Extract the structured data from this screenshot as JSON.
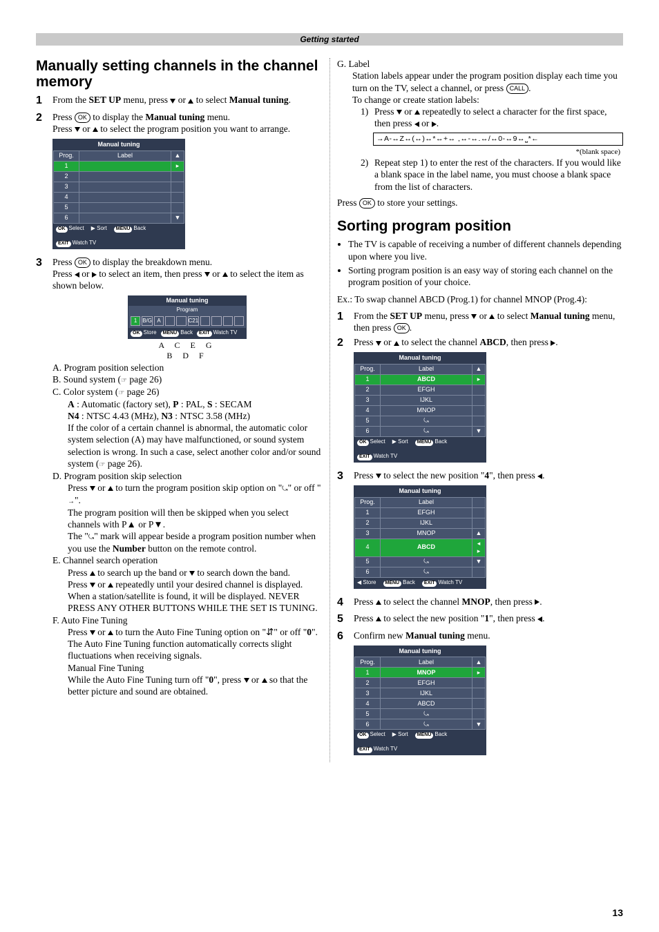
{
  "header": {
    "section": "Getting started"
  },
  "left": {
    "h1": "Manually setting channels in the channel memory",
    "step1_a": "From the ",
    "step1_b": "SET UP",
    "step1_c": " menu, press ",
    "step1_d": " or ",
    "step1_e": " to select ",
    "step1_f": "Manual tuning",
    "step1_g": ".",
    "step2_a": "Press ",
    "step2_ok": "OK",
    "step2_b": " to display the ",
    "step2_c": "Manual tuning",
    "step2_d": " menu.",
    "step2_e": "Press ",
    "step2_f": " or ",
    "step2_g": " to select the program position you want to arrange.",
    "osd1": {
      "title": "Manual tuning",
      "progLabel": "Prog.",
      "labelLabel": "Label",
      "rows": [
        "1",
        "2",
        "3",
        "4",
        "5",
        "6"
      ],
      "foot_select": "Select",
      "foot_sort": "Sort",
      "foot_back": "Back",
      "foot_watch": "Watch TV",
      "ok": "OK",
      "menu": "MENU",
      "exit": "EXIT"
    },
    "step3_a": "Press ",
    "step3_b": " to display the breakdown menu.",
    "step3_c": "Press ",
    "step3_d": " or ",
    "step3_e": " to select an item, then press ",
    "step3_f": " or ",
    "step3_g": " to select the item as shown below.",
    "osd2": {
      "title": "Manual tuning",
      "subtitle": "Program",
      "boxes": [
        "1",
        "B/G",
        "A",
        "",
        "",
        "C21",
        "",
        "",
        "",
        "",
        ""
      ],
      "store": "Store",
      "back": "Back",
      "watch": "Watch TV",
      "ok": "OK",
      "menu": "MENU",
      "exit": "EXIT"
    },
    "braces": "A   C   E             G",
    "braces2": "B   D   F",
    "A_label": "A. Program position selection",
    "B_label": "B. Sound system (",
    "B_ref": " page 26)",
    "C_label": "C. Color system (",
    "C_ref": " page 26)",
    "C_A": "A",
    "C_Atext": " : Automatic (factory set), ",
    "C_P": "P",
    "C_Ptext": " : PAL, ",
    "C_S": "S",
    "C_Stext": " : SECAM",
    "C_N4": "N4",
    "C_N4text": " : NTSC 4.43 (MHz), ",
    "C_N3": "N3",
    "C_N3text": " : NTSC 3.58 (MHz)",
    "C_expl": "If the color of a certain channel is abnormal, the automatic color system selection (A) may have malfunctioned, or sound system selection is wrong. In such a case, select another color and/or sound system (",
    "C_expl2": " page 26).",
    "D_label": "D. Program position skip selection",
    "D_a": "Press ",
    "D_b": " or ",
    "D_c": " to turn the program position skip option on \"",
    "D_d": "\" or off \"",
    "D_e": "\".",
    "D_f": "The program position will then be skipped when you select channels with P",
    "D_g": " or P",
    "D_h": ".",
    "D_i": "The \"",
    "D_j": "\" mark will appear beside a program position number when you use the ",
    "D_k": "Number",
    "D_l": " button on the remote control.",
    "E_label": "E. Channel search operation",
    "E_a": "Press ",
    "E_b": " to search up the band or ",
    "E_c": " to search down the band.",
    "E_d": "Press ",
    "E_e": " or ",
    "E_f": " repeatedly until your desired channel is displayed.",
    "E_g": "When a station/satellite is found, it will be displayed. NEVER PRESS ANY OTHER BUTTONS WHILE THE SET IS TUNING.",
    "F_label": "F. Auto Fine Tuning",
    "F_a": "Press ",
    "F_b": " or ",
    "F_c": " to turn the Auto Fine Tuning option on \"",
    "F_d": "\" or off \"",
    "F_e": "0",
    "F_f": "\".",
    "F_g": "The Auto Fine Tuning function automatically corrects slight fluctuations when receiving signals.",
    "F_h": "Manual Fine Tuning",
    "F_i": "While the Auto Fine Tuning turn off \"",
    "F_j": "0",
    "F_k": "\", press ",
    "F_l": " or ",
    "F_m": " so that the better picture and sound are obtained."
  },
  "right": {
    "G_label": "G. Label",
    "G_a": "Station labels appear under the program position display each time you turn on the TV, select a channel, or press ",
    "G_call": "CALL",
    "G_b": ".",
    "G_c": "To change or create station labels:",
    "G_1a": "Press ",
    "G_1b": " or ",
    "G_1c": " repeatedly to select a character for the first space, then press ",
    "G_1d": " or ",
    "G_1e": ".",
    "charset": "→A-↔Z↔(↔)↔*↔+↔ ,↔-↔.↔/↔0-↔9↔⎵*←",
    "blank": "*(blank space)",
    "G_2a": "Repeat step 1) to enter the rest of the characters. If you would like a blank space in the label name, you must choose a blank space from the list of characters.",
    "G_press": "Press ",
    "G_store": " to store your settings.",
    "h2": "Sorting program position",
    "b1": "The TV is capable of receiving a number of different channels depending upon where you live.",
    "b2": "Sorting program position is an easy way of storing each channel on the program position of your choice.",
    "ex": "Ex.: To swap channel ABCD (Prog.1) for channel MNOP (Prog.4):",
    "s1_a": "From the ",
    "s1_b": "SET UP",
    "s1_c": " menu, press ",
    "s1_d": " or ",
    "s1_e": " to select ",
    "s1_f": "Manual tuning",
    "s1_g": " menu, then press ",
    "s1_ok": "OK",
    "s1_h": ".",
    "s2_a": "Press  ",
    "s2_b": " or ",
    "s2_c": " to select the channel ",
    "s2_d": "ABCD",
    "s2_e": ", then press ",
    "osdA": {
      "title": "Manual tuning",
      "prog": "Prog.",
      "label": "Label",
      "rows": [
        [
          "1",
          "ABCD"
        ],
        [
          "2",
          "EFGH"
        ],
        [
          "3",
          "IJKL"
        ],
        [
          "4",
          "MNOP"
        ],
        [
          "5",
          ""
        ],
        [
          "6",
          ""
        ]
      ],
      "sel": 0,
      "ok": "OK",
      "sort": "Sort",
      "menu": "MENU",
      "back": "Back",
      "exit": "EXIT",
      "watch": "Watch TV",
      "select": "Select"
    },
    "s3_a": "Press ",
    "s3_b": " to select the new position \"",
    "s3_c": "4",
    "s3_d": "\", then press ",
    "osdB": {
      "title": "Manual tuning",
      "prog": "Prog.",
      "label": "Label",
      "rows": [
        [
          "1",
          "EFGH"
        ],
        [
          "2",
          "IJKL"
        ],
        [
          "3",
          "MNOP"
        ],
        [
          "4",
          "ABCD"
        ],
        [
          "5",
          ""
        ],
        [
          "6",
          ""
        ]
      ],
      "sel": 3,
      "store": "Store",
      "menu": "MENU",
      "back": "Back",
      "exit": "EXIT",
      "watch": "Watch TV"
    },
    "s4_a": "Press ",
    "s4_b": " to select the channel ",
    "s4_c": "MNOP",
    "s4_d": ", then press ",
    "s5_a": "Press ",
    "s5_b": " to select the new position \"",
    "s5_c": "1",
    "s5_d": "\", then press ",
    "s6_a": "Confirm new ",
    "s6_b": "Manual tuning",
    "s6_c": " menu.",
    "osdC": {
      "title": "Manual tuning",
      "prog": "Prog.",
      "label": "Label",
      "rows": [
        [
          "1",
          "MNOP"
        ],
        [
          "2",
          "EFGH"
        ],
        [
          "3",
          "IJKL"
        ],
        [
          "4",
          "ABCD"
        ],
        [
          "5",
          ""
        ],
        [
          "6",
          ""
        ]
      ],
      "sel": 0,
      "ok": "OK",
      "sort": "Sort",
      "menu": "MENU",
      "back": "Back",
      "exit": "EXIT",
      "watch": "Watch TV",
      "select": "Select"
    }
  },
  "page": "13"
}
